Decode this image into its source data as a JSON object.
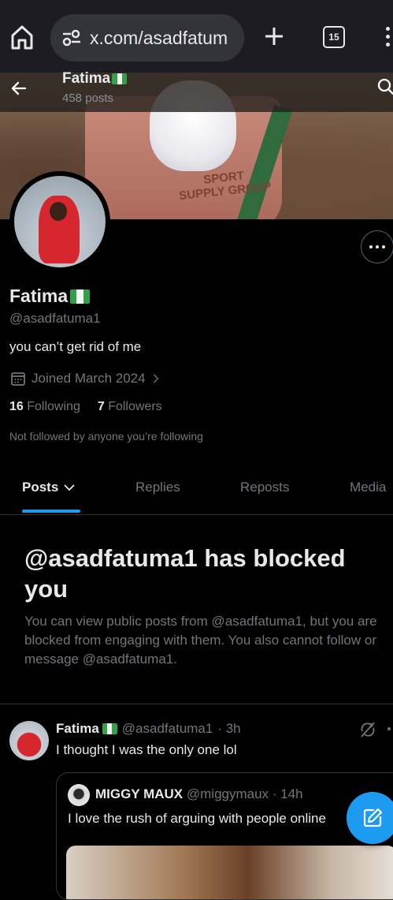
{
  "browser": {
    "url": "x.com/asadfatum",
    "tab_count": "15"
  },
  "banner": {
    "bucket_text": "SPORT\nSUPPLY GROUP"
  },
  "header": {
    "name": "Fatima",
    "post_count": "458 posts"
  },
  "profile": {
    "name": "Fatima",
    "handle": "@asadfatuma1",
    "bio": "you can’t get rid of me",
    "joined": "Joined March 2024",
    "following_count": "16",
    "following_label": "Following",
    "followers_count": "7",
    "followers_label": "Followers",
    "not_followed": "Not followed by anyone you’re following"
  },
  "tabs": [
    {
      "label": "Posts",
      "active": true
    },
    {
      "label": "Replies",
      "active": false
    },
    {
      "label": "Reposts",
      "active": false
    },
    {
      "label": "Media",
      "active": false
    }
  ],
  "blocked": {
    "title": "@asadfatuma1 has blocked you",
    "description": "You can view public posts from @asadfatuma1, but you are blocked from engaging with them. You also cannot follow or message @asadfatuma1."
  },
  "post": {
    "name": "Fatima",
    "handle": "@asadfatuma1",
    "time": "· 3h",
    "text": "I thought I was the only one lol",
    "quote": {
      "name": "MIGGY MAUX",
      "handle": "@miggymaux",
      "time": "· 14h",
      "text": "I love the rush of arguing with people online"
    }
  },
  "colors": {
    "accent": "#1d9bf0",
    "muted": "#71767b",
    "flag_green": "#2fa24a"
  },
  "icons": [
    "home-icon",
    "tune-icon",
    "plus-icon",
    "tabs-icon",
    "more-vertical-icon",
    "back-arrow-icon",
    "search-icon",
    "calendar-icon",
    "chevron-right-icon",
    "chevron-down-icon",
    "repost-icon",
    "compose-icon"
  ]
}
